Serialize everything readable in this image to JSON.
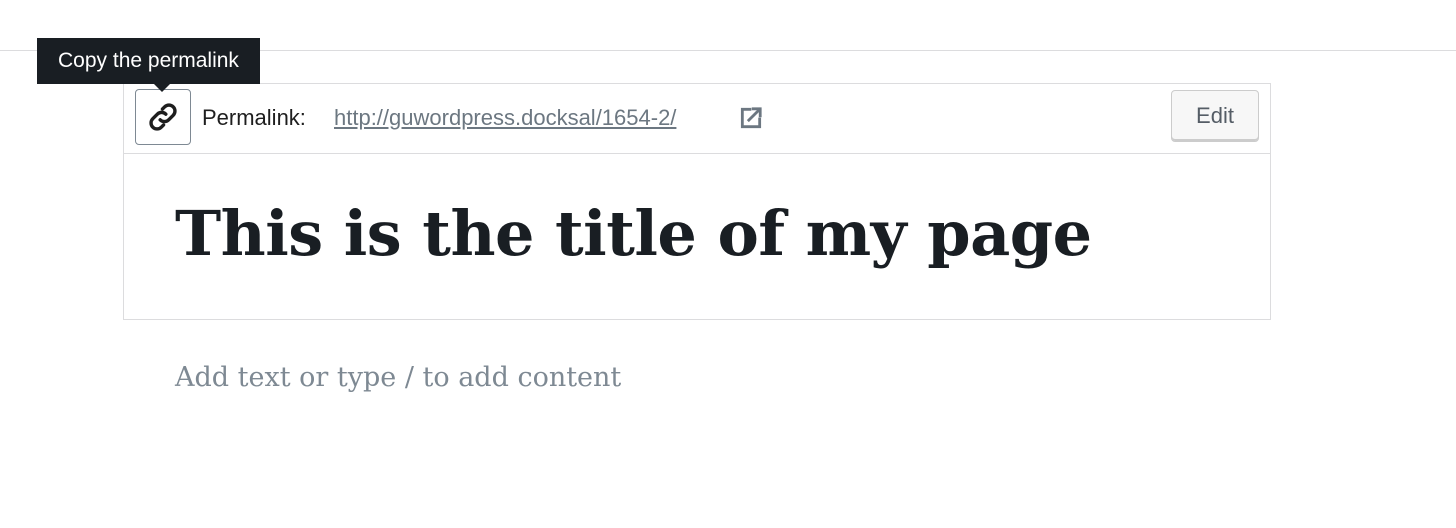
{
  "tooltip": {
    "text": "Copy the permalink"
  },
  "permalink": {
    "label": "Permalink:",
    "url": "http://guwordpress.docksal/1654-2/",
    "copy_icon": "link-icon",
    "external_icon": "external-link-icon",
    "edit_label": "Edit"
  },
  "editor": {
    "title": "This is the title of my page",
    "content_placeholder": "Add text or type / to add content"
  },
  "colors": {
    "tooltip_bg": "#191e23",
    "link_color": "#6c7781",
    "title_color": "#191e23",
    "placeholder_color": "#7e8993",
    "border": "#dcdcde"
  }
}
